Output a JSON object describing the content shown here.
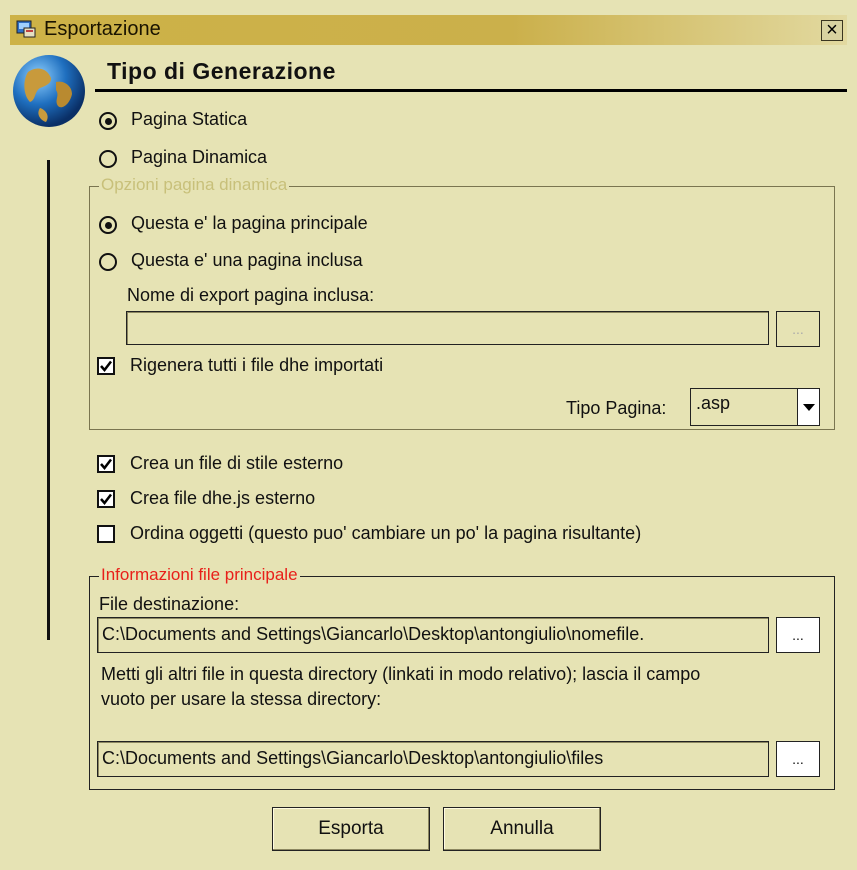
{
  "window": {
    "title": "Esportazione",
    "close_label": "×"
  },
  "heading": "Tipo di Generazione",
  "generation": {
    "static_label": "Pagina Statica",
    "dynamic_label": "Pagina Dinamica",
    "selected": "static"
  },
  "dynamic_options": {
    "legend": "Opzioni pagina dinamica",
    "main_page_label": "Questa e' la pagina principale",
    "included_page_label": "Questa e' una pagina inclusa",
    "selected": "main",
    "export_name_label": "Nome di export pagina inclusa:",
    "export_name_value": "",
    "browse_label": "...",
    "regenerate_label": "Rigenera tutti i file dhe importati",
    "regenerate_checked": true,
    "page_type_label": "Tipo Pagina:",
    "page_type_value": ".asp"
  },
  "options": {
    "external_style_label": "Crea un file di stile esterno",
    "external_style_checked": true,
    "external_js_label": "Crea file dhe.js esterno",
    "external_js_checked": true,
    "sort_objects_label": "Ordina oggetti (questo puo' cambiare un po' la pagina risultante)",
    "sort_objects_checked": false
  },
  "main_file": {
    "legend": "Informazioni file principale",
    "dest_label": "File destinazione:",
    "dest_value": "C:\\Documents and Settings\\Giancarlo\\Desktop\\antongiulio\\nomefile.",
    "dir_help_line1": "Metti gli altri file in questa directory (linkati in modo relativo); lascia il campo",
    "dir_help_line2": "vuoto per usare la stessa directory:",
    "dir_value": "C:\\Documents and Settings\\Giancarlo\\Desktop\\antongiulio\\files",
    "browse_label": "..."
  },
  "buttons": {
    "export_label": "Esporta",
    "cancel_label": "Annulla"
  },
  "colors": {
    "background": "#e6e3b4",
    "legend_disabled": "#c8c07a",
    "legend_accent": "#e8201a"
  }
}
